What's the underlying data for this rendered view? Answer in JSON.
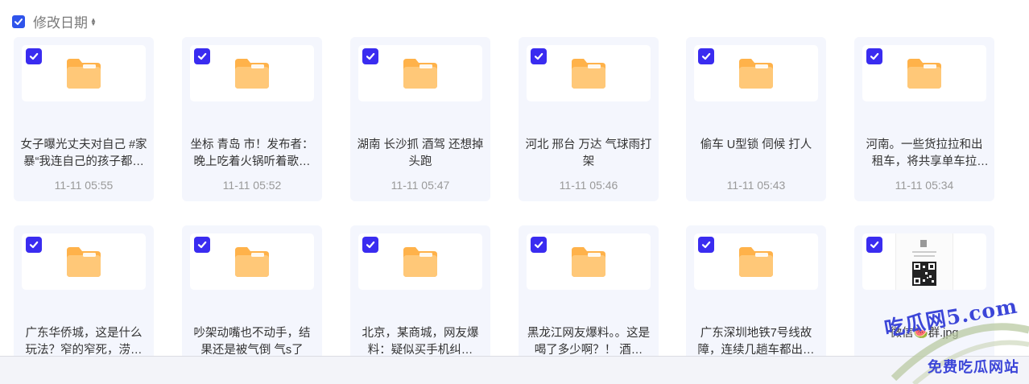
{
  "header": {
    "sort_label": "修改日期",
    "select_all_checked": true
  },
  "files": [
    {
      "name": "女子曝光丈夫对自己 #家暴“我连自己的孩子都…",
      "date": "11-11 05:55",
      "type": "folder",
      "checked": true
    },
    {
      "name": "坐标 青岛 市！发布者：晚上吃着火锅听着歌…",
      "date": "11-11 05:52",
      "type": "folder",
      "checked": true
    },
    {
      "name": "湖南 长沙抓 酒驾 还想掉头跑",
      "date": "11-11 05:47",
      "type": "folder",
      "checked": true
    },
    {
      "name": "河北 邢台 万达 气球雨打架",
      "date": "11-11 05:46",
      "type": "folder",
      "checked": true
    },
    {
      "name": "偷车 U型锁 伺候 打人",
      "date": "11-11 05:43",
      "type": "folder",
      "checked": true
    },
    {
      "name": "河南。一些货拉拉和出租车，将共享单车拉走…",
      "date": "11-11 05:34",
      "type": "folder",
      "checked": true
    },
    {
      "name": "广东华侨城，这是什么玩法？窄的窄死，涝…",
      "date": "",
      "type": "folder",
      "checked": true
    },
    {
      "name": "吵架动嘴也不动手，结果还是被气倒 气s了",
      "date": "",
      "type": "folder",
      "checked": true
    },
    {
      "name": "北京，某商城，网友爆料：疑似买手机纠…",
      "date": "",
      "type": "folder",
      "checked": true
    },
    {
      "name": "黑龙江网友爆料。。这是喝了多少啊？！ 酒…",
      "date": "",
      "type": "folder",
      "checked": true
    },
    {
      "name": "广东深圳地铁7号线故障，连续几趟车都出…",
      "date": "",
      "type": "folder",
      "checked": true
    },
    {
      "name": "微信🍉群.jpg",
      "date": "",
      "type": "image",
      "checked": true
    }
  ],
  "colors": {
    "accent": "#3a2cf0",
    "card_bg": "#f4f6fd",
    "folder_body": "#ffc46b",
    "folder_tab": "#ffb24a"
  },
  "watermark": {
    "line1": "吃瓜网5.com",
    "line2": "免费吃瓜网站"
  }
}
